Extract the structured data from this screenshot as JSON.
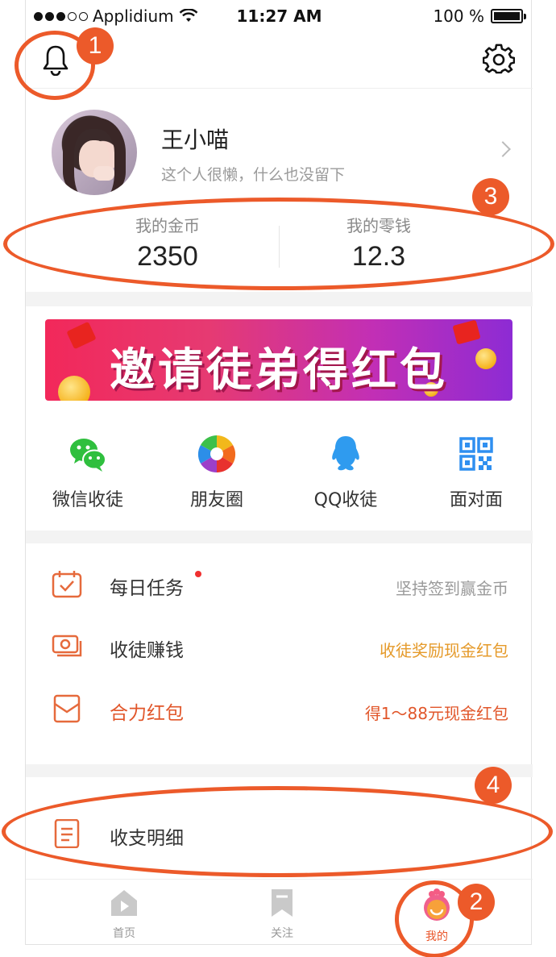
{
  "status_bar": {
    "carrier": "Applidium",
    "time": "11:27 AM",
    "battery_pct": "100 %"
  },
  "profile": {
    "name": "王小喵",
    "bio": "这个人很懒，什么也没留下"
  },
  "wallet": {
    "coins_label": "我的金币",
    "coins_value": "2350",
    "change_label": "我的零钱",
    "change_value": "12.3"
  },
  "banner": {
    "text": "邀请徒弟得红包"
  },
  "share": {
    "items": [
      {
        "label": "微信收徒",
        "icon": "wechat-icon"
      },
      {
        "label": "朋友圈",
        "icon": "moments-icon"
      },
      {
        "label": "QQ收徒",
        "icon": "qq-icon"
      },
      {
        "label": "面对面",
        "icon": "qrcode-icon"
      }
    ]
  },
  "menu": {
    "items": [
      {
        "label": "每日任务",
        "hint": "坚持签到赢金币",
        "icon": "calendar-icon"
      },
      {
        "label": "收徒赚钱",
        "hint": "收徒奖励现金红包",
        "icon": "cash-icon"
      },
      {
        "label": "合力红包",
        "hint": "得1～88元现金红包",
        "icon": "red-envelope-icon"
      }
    ],
    "ledger": {
      "label": "收支明细",
      "icon": "document-icon"
    }
  },
  "tabbar": {
    "items": [
      {
        "label": "首页",
        "icon": "home-icon"
      },
      {
        "label": "关注",
        "icon": "bookmark-icon"
      },
      {
        "label": "我的",
        "icon": "mascot-icon"
      }
    ],
    "active": "我的"
  },
  "annotations": [
    "1",
    "2",
    "3",
    "4"
  ],
  "colors": {
    "accent": "#e9552a",
    "annotation": "#ec5a2a",
    "hint_orange": "#e59a2a",
    "banner_start": "#f2285a",
    "banner_end": "#8d2bd4"
  }
}
